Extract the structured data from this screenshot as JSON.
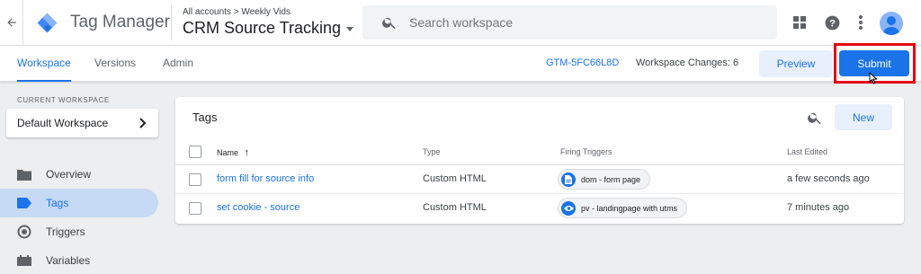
{
  "header": {
    "app_name": "Tag Manager",
    "breadcrumb": "All accounts > Weekly Vids",
    "container_name": "CRM Source Tracking",
    "search": {
      "placeholder": "Search workspace"
    },
    "icons": [
      "back-arrow-icon",
      "apps-grid-icon",
      "help-icon",
      "more-vert-icon",
      "account-avatar"
    ]
  },
  "subnav": {
    "tabs": [
      {
        "label": "Workspace",
        "active": true
      },
      {
        "label": "Versions",
        "active": false
      },
      {
        "label": "Admin",
        "active": false
      }
    ],
    "container_id": "GTM-5FC66L8D",
    "workspace_changes": "Workspace Changes: 6",
    "preview_label": "Preview",
    "submit_label": "Submit"
  },
  "sidebar": {
    "current_workspace_label": "CURRENT WORKSPACE",
    "workspace_name": "Default Workspace",
    "items": [
      {
        "label": "Overview",
        "icon": "folder-icon",
        "active": false
      },
      {
        "label": "Tags",
        "icon": "tag-icon",
        "active": true
      },
      {
        "label": "Triggers",
        "icon": "trigger-icon",
        "active": false
      },
      {
        "label": "Variables",
        "icon": "variables-icon",
        "active": false
      }
    ]
  },
  "tags_card": {
    "title": "Tags",
    "new_label": "New",
    "columns": [
      "Name",
      "Type",
      "Firing Triggers",
      "Last Edited"
    ],
    "sort_indicator": "↑",
    "rows": [
      {
        "name": "form fill for source info",
        "type": "Custom HTML",
        "trigger": "dom - form page",
        "trigger_icon": "document-icon",
        "last_edited": "a few seconds ago"
      },
      {
        "name": "set cookie - source",
        "type": "Custom HTML",
        "trigger": "pv - landingpage with utms",
        "trigger_icon": "eye-icon",
        "last_edited": "7 minutes ago"
      }
    ]
  },
  "colors": {
    "accent": "#1a73e8",
    "highlight": "#e30613",
    "active_nav_bg": "#c6d9f5"
  }
}
